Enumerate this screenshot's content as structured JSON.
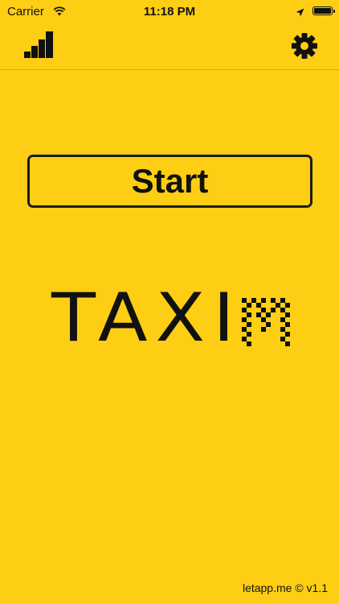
{
  "status_bar": {
    "carrier": "Carrier",
    "time": "11:18 PM",
    "wifi_icon": "wifi-icon",
    "location_icon": "location-arrow-icon",
    "battery_icon": "battery-icon"
  },
  "navbar": {
    "left_icon": "bar-chart-icon",
    "right_icon": "gear-icon"
  },
  "main": {
    "start_label": "Start",
    "logo_text": "TAXI",
    "logo_mark": "checkered-m-icon"
  },
  "footer": {
    "text": "letapp.me © v1.1"
  },
  "colors": {
    "background": "#FECE14",
    "foreground": "#111111",
    "divider": "#D9AF0E"
  }
}
